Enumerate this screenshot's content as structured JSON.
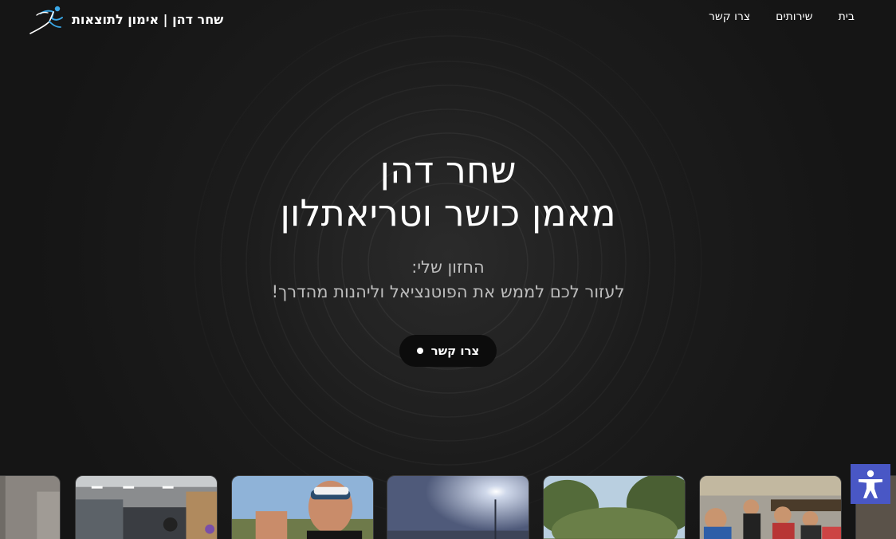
{
  "header": {
    "brand_name": "שחר דהן | אימון לתוצאות",
    "logo_icon": "runner-icon",
    "nav": [
      {
        "label": "בית"
      },
      {
        "label": "שירותים"
      },
      {
        "label": "צרו קשר"
      }
    ]
  },
  "hero": {
    "title_line1": "שחר דהן",
    "title_line2": "מאמן כושר וטריאתלון",
    "subtitle_line1": "החזון שלי:",
    "subtitle_line2": "לעזור לכם לממש את הפוטנציאל וליהנות מהדרך!",
    "cta_label": "צרו קשר"
  },
  "gallery": {
    "photos": [
      "gym-scene",
      "gym-scene",
      "cyclist-selfie",
      "sky-sun-scene",
      "forest-scene",
      "group-cyclists-scene",
      "partial-photo"
    ]
  },
  "accessibility": {
    "icon": "accessibility-icon"
  },
  "colors": {
    "background": "#161616",
    "cta_background": "#0c0c0c",
    "accessibility_button": "#4957c5",
    "logo_accent": "#3aa8e8"
  }
}
